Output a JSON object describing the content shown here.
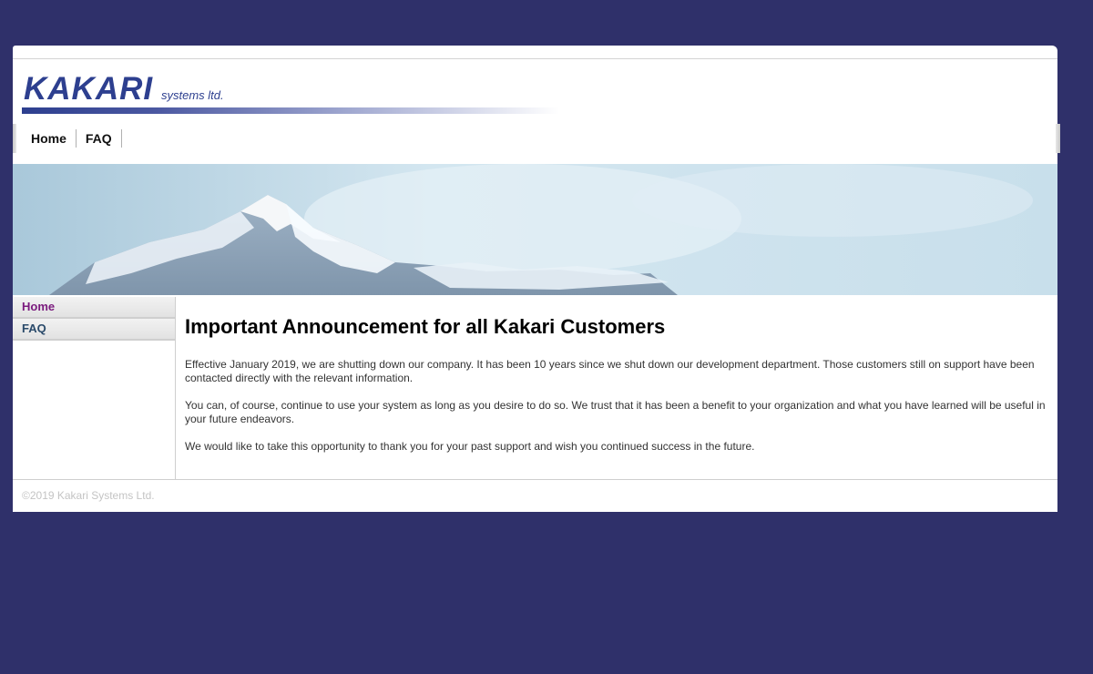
{
  "brand": {
    "name": "KAKARI",
    "tagline": "systems ltd.",
    "color": "#2d3f8f"
  },
  "topnav": {
    "items": [
      {
        "label": "Home"
      },
      {
        "label": "FAQ"
      }
    ]
  },
  "sidebar": {
    "items": [
      {
        "label": "Home",
        "active": true
      },
      {
        "label": "FAQ",
        "active": false
      }
    ]
  },
  "main": {
    "title": "Important Announcement for all Kakari Customers",
    "paragraphs": [
      "Effective January 2019, we are shutting down our company. It has been 10 years since we shut down our development department. Those customers still on support have been contacted directly with the relevant information.",
      "You can, of course, continue to use your system as long as you desire to do so. We trust that it has been a benefit to your organization and what you have learned will be useful in your future endeavors.",
      "We would like to take this opportunity to thank you for your past support and wish you continued success in the future."
    ]
  },
  "footer": {
    "copyright": "©2019 Kakari Systems Ltd."
  },
  "colors": {
    "background": "#2f306a",
    "active_link": "#7b1b7e",
    "nav_link": "#2a4a6a"
  }
}
